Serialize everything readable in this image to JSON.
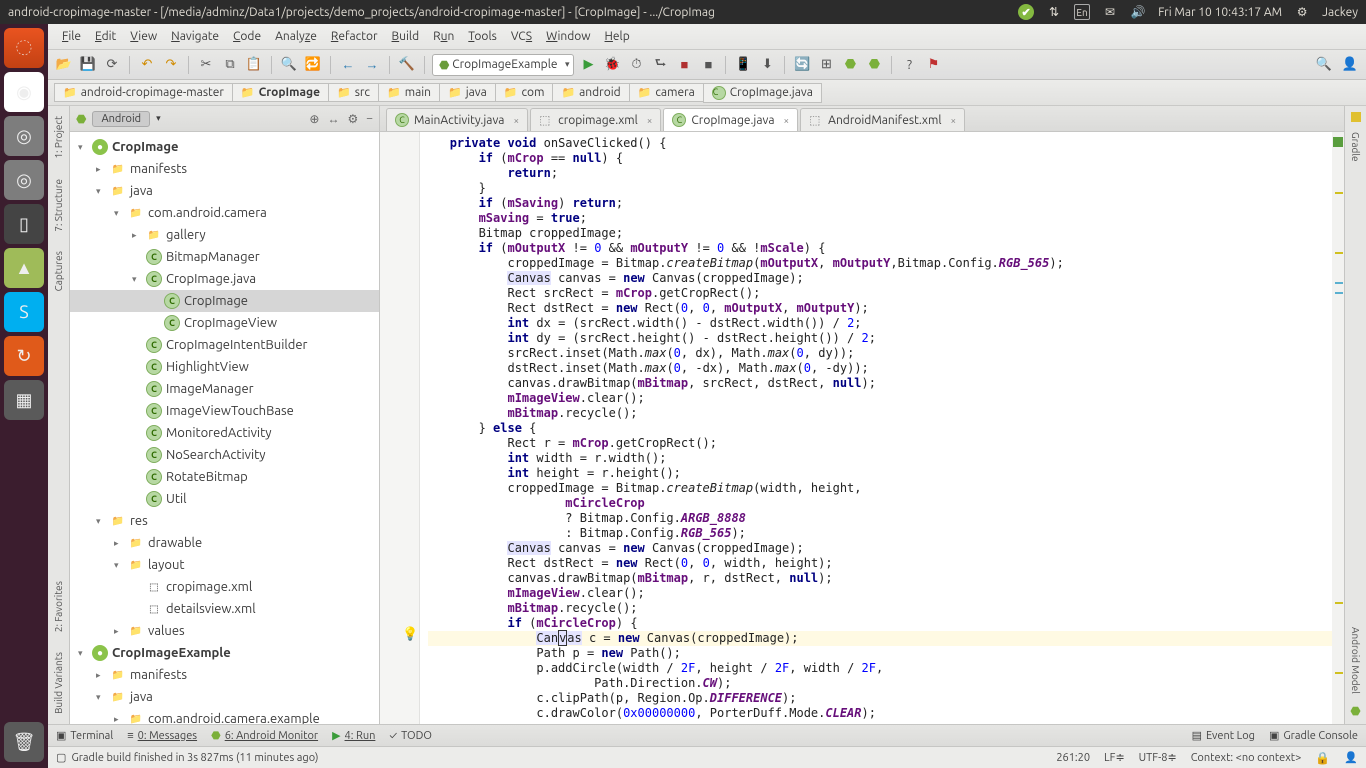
{
  "topbar": {
    "title": "android-cropimage-master - [/media/adminz/Data1/projects/demo_projects/android-cropimage-master] - [CropImage] - .../CropImag",
    "datetime": "Fri Mar 10 10:43:17 AM",
    "user": "Jackey",
    "lang": "En"
  },
  "menu": {
    "items": [
      "File",
      "Edit",
      "View",
      "Navigate",
      "Code",
      "Analyze",
      "Refactor",
      "Build",
      "Run",
      "Tools",
      "VCS",
      "Window",
      "Help"
    ]
  },
  "runcombo": "CropImageExample",
  "breadcrumb": [
    "android-cropimage-master",
    "CropImage",
    "src",
    "main",
    "java",
    "com",
    "android",
    "camera",
    "CropImage.java"
  ],
  "projheader": {
    "label": "Android"
  },
  "tree": [
    {
      "d": 0,
      "arrow": "▾",
      "ic": "mod",
      "t": "CropImage",
      "bold": true
    },
    {
      "d": 1,
      "arrow": "▸",
      "ic": "dir",
      "t": "manifests"
    },
    {
      "d": 1,
      "arrow": "▾",
      "ic": "dir",
      "t": "java"
    },
    {
      "d": 2,
      "arrow": "▾",
      "ic": "pkg",
      "t": "com.android.camera"
    },
    {
      "d": 3,
      "arrow": "▸",
      "ic": "pkg",
      "t": "gallery"
    },
    {
      "d": 3,
      "arrow": "",
      "ic": "class",
      "t": "BitmapManager"
    },
    {
      "d": 3,
      "arrow": "▾",
      "ic": "class",
      "t": "CropImage.java"
    },
    {
      "d": 4,
      "arrow": "",
      "ic": "class",
      "t": "CropImage",
      "sel": true
    },
    {
      "d": 4,
      "arrow": "",
      "ic": "class",
      "t": "CropImageView"
    },
    {
      "d": 3,
      "arrow": "",
      "ic": "class",
      "t": "CropImageIntentBuilder"
    },
    {
      "d": 3,
      "arrow": "",
      "ic": "class",
      "t": "HighlightView"
    },
    {
      "d": 3,
      "arrow": "",
      "ic": "class",
      "t": "ImageManager"
    },
    {
      "d": 3,
      "arrow": "",
      "ic": "class",
      "t": "ImageViewTouchBase"
    },
    {
      "d": 3,
      "arrow": "",
      "ic": "class",
      "t": "MonitoredActivity"
    },
    {
      "d": 3,
      "arrow": "",
      "ic": "class",
      "t": "NoSearchActivity"
    },
    {
      "d": 3,
      "arrow": "",
      "ic": "class",
      "t": "RotateBitmap"
    },
    {
      "d": 3,
      "arrow": "",
      "ic": "class",
      "t": "Util"
    },
    {
      "d": 1,
      "arrow": "▾",
      "ic": "dir",
      "t": "res"
    },
    {
      "d": 2,
      "arrow": "▸",
      "ic": "dir",
      "t": "drawable"
    },
    {
      "d": 2,
      "arrow": "▾",
      "ic": "dir",
      "t": "layout"
    },
    {
      "d": 3,
      "arrow": "",
      "ic": "xml",
      "t": "cropimage.xml"
    },
    {
      "d": 3,
      "arrow": "",
      "ic": "xml",
      "t": "detailsview.xml"
    },
    {
      "d": 2,
      "arrow": "▸",
      "ic": "dir",
      "t": "values"
    },
    {
      "d": 0,
      "arrow": "▾",
      "ic": "mod",
      "t": "CropImageExample",
      "bold": true
    },
    {
      "d": 1,
      "arrow": "▸",
      "ic": "dir",
      "t": "manifests"
    },
    {
      "d": 1,
      "arrow": "▾",
      "ic": "dir",
      "t": "java"
    },
    {
      "d": 2,
      "arrow": "▸",
      "ic": "pkg",
      "t": "com.android.camera.example"
    }
  ],
  "tabs": [
    {
      "label": "MainActivity.java",
      "ic": "class"
    },
    {
      "label": "cropimage.xml",
      "ic": "xml"
    },
    {
      "label": "CropImage.java",
      "ic": "class",
      "active": true
    },
    {
      "label": "AndroidManifest.xml",
      "ic": "xml"
    }
  ],
  "bottom": {
    "terminal": "Terminal",
    "messages": "0: Messages",
    "android": "6: Android Monitor",
    "run": "4: Run",
    "todo": "TODO",
    "eventlog": "Event Log",
    "gradle": "Gradle Console"
  },
  "status": {
    "msg": "Gradle build finished in 3s 827ms (11 minutes ago)",
    "pos": "261:20",
    "le": "LF",
    "enc": "UTF-8",
    "ctx": "Context: <no context>"
  },
  "leftgutter": [
    "1: Project",
    "7: Structure",
    "Captures",
    "2: Favorites",
    "Build Variants"
  ],
  "rightgutter": [
    "Gradle",
    "Android Model"
  ]
}
